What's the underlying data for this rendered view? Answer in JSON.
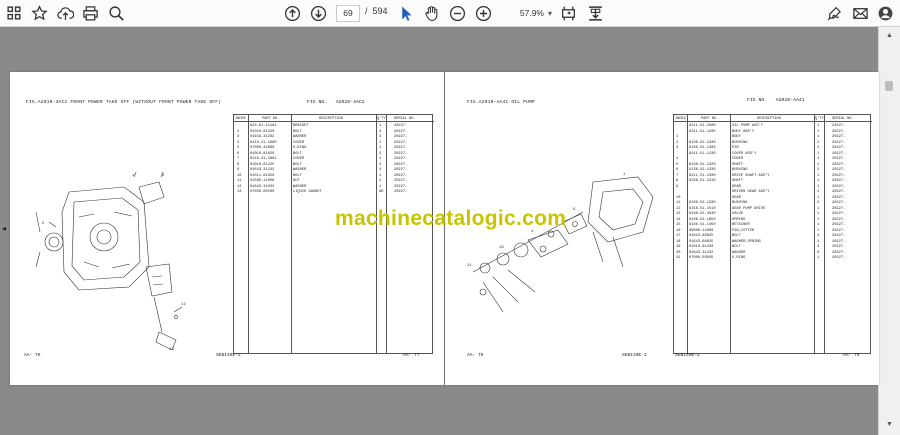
{
  "toolbar": {
    "page_current": "69",
    "page_separator": "/",
    "page_total": "594",
    "zoom": "57.9%"
  },
  "watermark": "machinecatalogic.com",
  "left_page": {
    "fig_title": "FIG.A2010-4AC2  FRONT POWER TAKE OFF (WITHOUT FRONT POWER TAKE OFF)",
    "fig_no_label": "FIG NO.",
    "fig_no": "A2010-4AC2",
    "headers": [
      "INDEX",
      "PART NO.",
      "DESCRIPTION",
      "Q'TY",
      "SERIAL NO."
    ],
    "rows": [
      {
        "i": "",
        "p": "A23-61-11181",
        "d": "BRACKET",
        "q": "1",
        "s": "20227-"
      },
      {
        "i": "2",
        "p": "01010-81220",
        "d": "BOLT",
        "q": "3",
        "s": "20227-"
      },
      {
        "i": "3",
        "p": "01643-31232",
        "d": "WASHER",
        "q": "3",
        "s": "20227-"
      },
      {
        "i": "4",
        "p": "6210-21-1660",
        "d": "COVER",
        "q": "1",
        "s": "20227-"
      },
      {
        "i": "5",
        "p": "07000-42090",
        "d": "O-RING",
        "q": "1",
        "s": "20227-"
      },
      {
        "i": "6",
        "p": "01010-81020",
        "d": "BOLT",
        "q": "3",
        "s": "20227-"
      },
      {
        "i": "7",
        "p": "6210-21-1891",
        "d": "COVER",
        "q": "1",
        "s": "20227-"
      },
      {
        "i": "8",
        "p": "01010-81225",
        "d": "BOLT",
        "q": "4",
        "s": "20227-"
      },
      {
        "i": "9",
        "p": "01643-31232",
        "d": "WASHER",
        "q": "4",
        "s": "20227-"
      },
      {
        "i": "10",
        "p": "01011-81020",
        "d": "BOLT",
        "q": "1",
        "s": "20227-"
      },
      {
        "i": "11",
        "p": "01580-11008",
        "d": "NUT",
        "q": "1",
        "s": "20227-"
      },
      {
        "i": "12",
        "p": "01643-31032",
        "d": "WASHER",
        "q": "1",
        "s": "20227-"
      },
      {
        "i": "13",
        "p": "07850-00100",
        "d": "LIQUID GASKET",
        "q": "AR",
        "s": "20227-"
      }
    ],
    "foot_left": "AA-  76",
    "foot_mid": "SEBI40E-2",
    "foot_right": "AA-  77"
  },
  "right_page": {
    "fig_title": "FIG.A2010-AA41  OIL PUMP",
    "fig_no_label": "FIG NO.",
    "fig_no": "A2010-AA41",
    "headers": [
      "INDEX",
      "PART NO.",
      "DESCRIPTION",
      "Q'TY",
      "SERIAL NO."
    ],
    "rows": [
      {
        "i": "",
        "p": "6211-51-1000",
        "d": "OIL PUMP ASS'Y",
        "q": "1",
        "s": "20227-"
      },
      {
        "i": "",
        "p": "6211-51-1200",
        "d": "BODY ASS'Y",
        "q": "1",
        "s": "20227-"
      },
      {
        "i": "1",
        "p": "",
        "d": "BODY",
        "q": "1",
        "s": "20227-"
      },
      {
        "i": "2",
        "p": "6136-52-1330",
        "d": "BUSHING",
        "q": "2",
        "s": "20227-"
      },
      {
        "i": "3",
        "p": "6136-52-1400",
        "d": "PIN",
        "q": "2",
        "s": "20227-"
      },
      {
        "i": "",
        "p": "6211-51-1130",
        "d": "COVER ASS'Y",
        "q": "1",
        "s": "20227-"
      },
      {
        "i": "4",
        "p": "",
        "d": "COVER",
        "q": "1",
        "s": "20227-"
      },
      {
        "i": "5",
        "p": "6136-51-1320",
        "d": "SHAFT",
        "q": "1",
        "s": "20227-"
      },
      {
        "i": "6",
        "p": "6136-52-1330",
        "d": "BUSHING",
        "q": "2",
        "s": "20227-"
      },
      {
        "i": "7",
        "p": "6211-51-1300",
        "d": "DRIVE SHAFT ASS'Y",
        "q": "1",
        "s": "20227-"
      },
      {
        "i": "8",
        "p": "6236-51-1310",
        "d": "SHAFT",
        "q": "1",
        "s": "20227-"
      },
      {
        "i": "9",
        "p": "",
        "d": "GEAR",
        "q": "1",
        "s": "20227-"
      },
      {
        "i": "",
        "p": "",
        "d": "DRIVEN GEAR ASS'Y",
        "q": "1",
        "s": "20227-"
      },
      {
        "i": "10",
        "p": "",
        "d": "GEAR",
        "q": "1",
        "s": "20227-"
      },
      {
        "i": "11",
        "p": "6136-52-1330",
        "d": "BUSHING",
        "q": "2",
        "s": "20227-"
      },
      {
        "i": "12",
        "p": "6218-51-1510",
        "d": "GEAR PUMP DRIVE",
        "q": "1",
        "s": "20227-"
      },
      {
        "i": "13",
        "p": "6136-52-1640",
        "d": "VALVE",
        "q": "1",
        "s": "20227-"
      },
      {
        "i": "14",
        "p": "6136-52-1650",
        "d": "SPRING",
        "q": "1",
        "s": "20227-"
      },
      {
        "i": "15",
        "p": "6140-51-1450",
        "d": "RETAINER",
        "q": "1",
        "s": "20227-"
      },
      {
        "i": "16",
        "p": "09000-14609",
        "d": "PIN,COTTER",
        "q": "1",
        "s": "20227-"
      },
      {
        "i": "17",
        "p": "01010-80825",
        "d": "BOLT",
        "q": "4",
        "s": "20227-"
      },
      {
        "i": "18",
        "p": "01643-60825",
        "d": "WASHER,SPRING",
        "q": "4",
        "s": "20227-"
      },
      {
        "i": "19",
        "p": "01010-81230",
        "d": "BOLT",
        "q": "3",
        "s": "20227-"
      },
      {
        "i": "20",
        "p": "01643-31232",
        "d": "WASHER",
        "q": "3",
        "s": "20227-"
      },
      {
        "i": "21",
        "p": "07000-03035",
        "d": "O-RING",
        "q": "1",
        "s": "20227-"
      }
    ],
    "foot_left": "AA-  78",
    "foot_mid": "SEBI40E-2",
    "foot_mid2": "SEBI40E-2",
    "foot_right": "AA-  79"
  }
}
